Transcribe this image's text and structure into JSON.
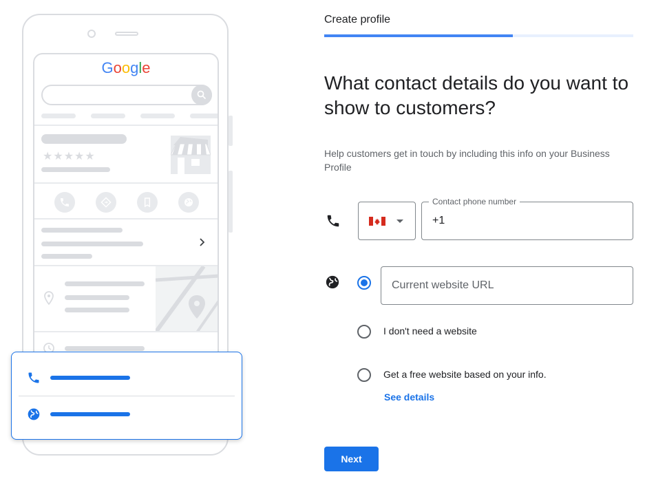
{
  "illustration": {
    "logo_letters": [
      "G",
      "o",
      "o",
      "g",
      "l",
      "e"
    ],
    "logo_colors": [
      "#4285f4",
      "#ea4335",
      "#fbbc05",
      "#4285f4",
      "#34a853",
      "#ea4335"
    ],
    "stars": "★★★★★",
    "icons": [
      "phone-icon",
      "directions-icon",
      "bookmark-icon",
      "globe-icon",
      "chevron-right-icon",
      "location-pin-icon",
      "clock-icon",
      "storefront-icon"
    ],
    "card_icons": [
      "phone-icon",
      "globe-icon"
    ]
  },
  "header": {
    "step_label": "Create profile",
    "progress": 0.61
  },
  "main": {
    "title": "What contact details do you want to show to customers?",
    "subtitle": "Help customers get in touch by including this info on your Business Profile"
  },
  "phone": {
    "icon": "phone-icon",
    "country": "Canada",
    "country_icon": "canada-flag-icon",
    "label": "Contact phone number",
    "value": "+1"
  },
  "website": {
    "icon": "globe-icon",
    "placeholder": "Current website URL",
    "options": [
      {
        "label": "Current website URL",
        "selected": true
      },
      {
        "label": "I don't need a website",
        "selected": false
      },
      {
        "label": "Get a free website based on your info.",
        "selected": false
      }
    ],
    "see_details": "See details"
  },
  "footer": {
    "next_label": "Next"
  },
  "colors": {
    "accent": "#1a73e8",
    "progress": "#4285f4",
    "progress_track": "#e8f0fe",
    "illustration_grey": "#dadce0"
  }
}
